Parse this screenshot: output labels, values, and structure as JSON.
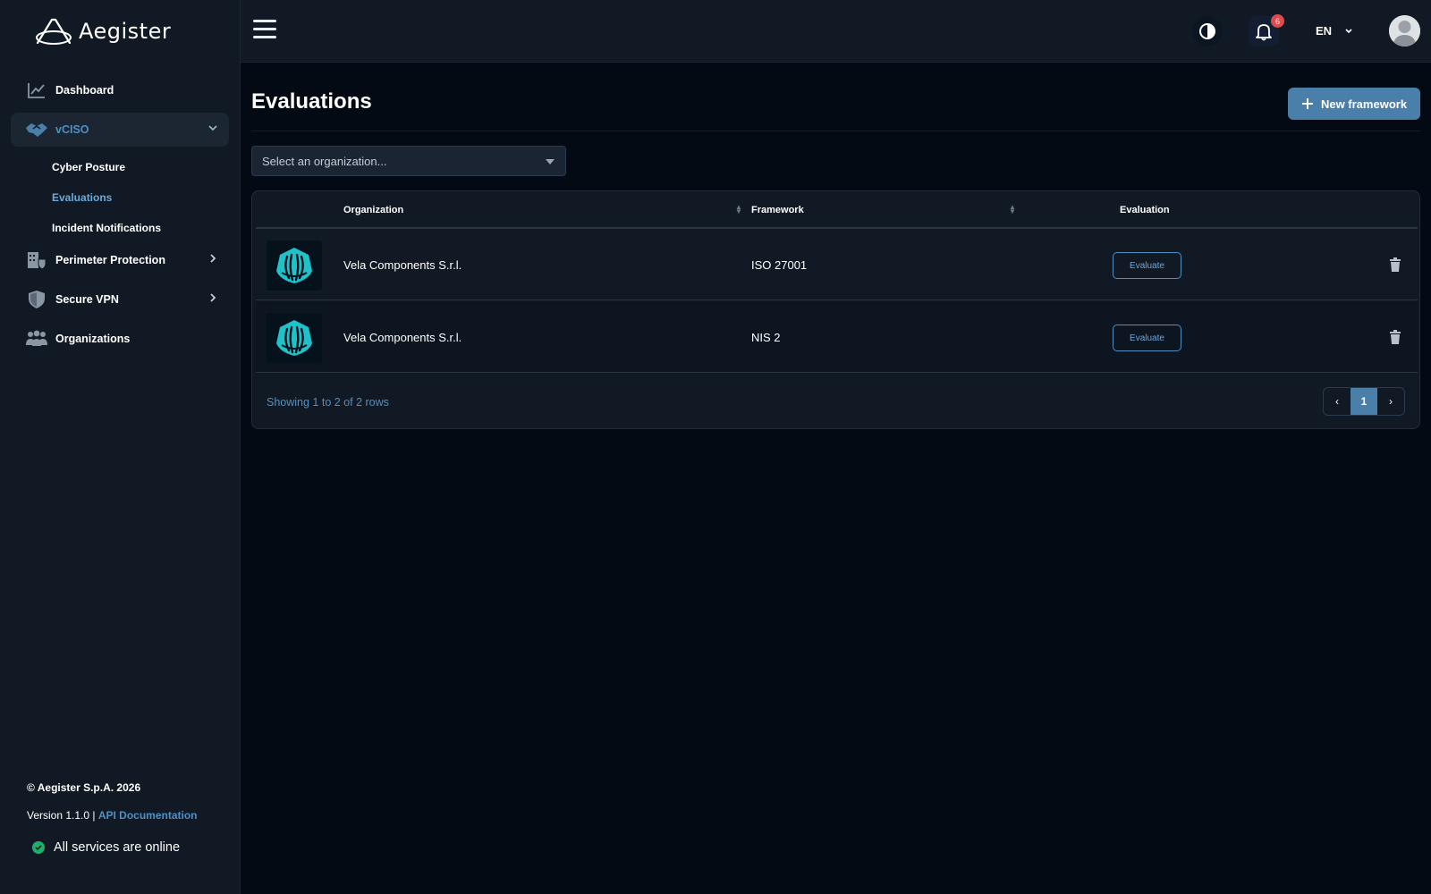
{
  "brand": {
    "name": "Aegister"
  },
  "sidebar": {
    "items": [
      {
        "label": "Dashboard",
        "icon": "chart-line-icon"
      },
      {
        "label": "vCISO",
        "icon": "handshake-icon",
        "expanded": true,
        "sub": [
          {
            "label": "Cyber Posture"
          },
          {
            "label": "Evaluations",
            "active": true
          },
          {
            "label": "Incident Notifications"
          }
        ]
      },
      {
        "label": "Perimeter Protection",
        "icon": "building-shield-icon"
      },
      {
        "label": "Secure VPN",
        "icon": "shield-icon"
      },
      {
        "label": "Organizations",
        "icon": "users-icon"
      }
    ],
    "footer": {
      "copyright": "© Aegister S.p.A. 2026",
      "version": "Version 1.1.0 | ",
      "api_link": "API Documentation",
      "status": "All services are online"
    }
  },
  "topbar": {
    "notifications_count": "6",
    "language": "EN"
  },
  "main": {
    "title": "Evaluations",
    "new_button": "New framework",
    "org_select_placeholder": "Select an organization...",
    "table": {
      "columns": [
        "Organization",
        "Framework",
        "Evaluation"
      ],
      "rows": [
        {
          "organization": "Vela Components S.r.l.",
          "framework": "ISO 27001",
          "action": "Evaluate"
        },
        {
          "organization": "Vela Components S.r.l.",
          "framework": "NIS 2",
          "action": "Evaluate"
        }
      ],
      "showing": "Showing 1 to 2 of 2 rows",
      "pagination": {
        "prev": "‹",
        "page": "1",
        "next": "›"
      }
    }
  },
  "colors": {
    "accent": "#4a7faa",
    "link": "#4f8fc2",
    "bg": "#030a14",
    "panel": "#111a24",
    "online": "#1fae6b",
    "badge": "#e04a4a",
    "logo_teal": "#1ec2c8"
  }
}
